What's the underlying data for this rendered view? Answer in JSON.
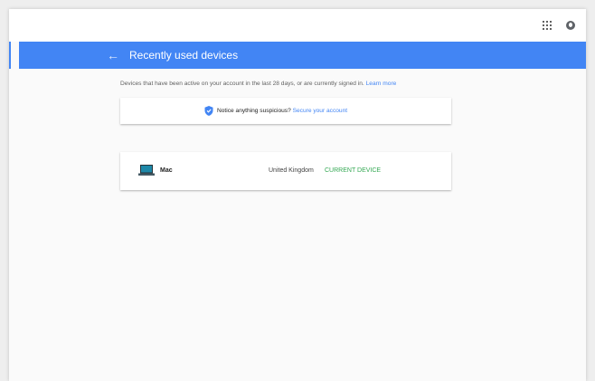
{
  "header": {
    "title": "Recently used devices",
    "back_icon": "arrow-back-icon",
    "apps_icon": "apps-grid-icon",
    "account_icon": "account-avatar-icon"
  },
  "intro": {
    "text": "Devices that have been active on your account in the last 28 days, or are currently signed in.",
    "learn_more": "Learn more"
  },
  "notice": {
    "icon": "shield-icon",
    "text": "Notice anything suspicious?",
    "link": "Secure your account"
  },
  "devices": [
    {
      "icon": "laptop-icon",
      "name": "Mac",
      "location": "United Kingdom",
      "status": "CURRENT DEVICE"
    }
  ],
  "colors": {
    "accent": "#4285f4",
    "current_device": "#34a853",
    "background": "#fafafa"
  }
}
